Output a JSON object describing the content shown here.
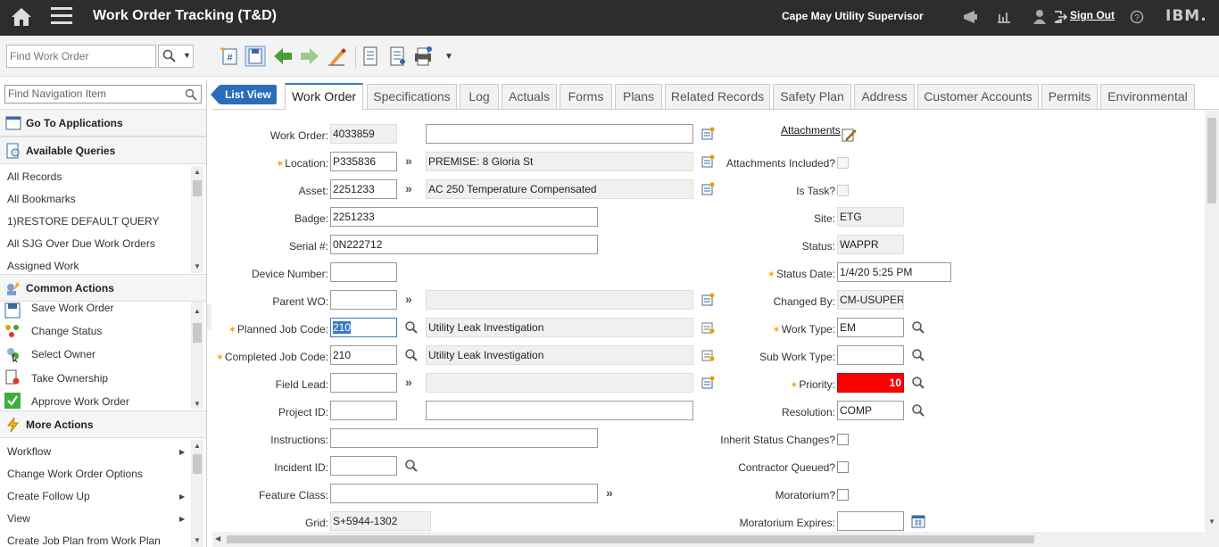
{
  "header": {
    "title": "Work Order Tracking (T&D)",
    "user": "Cape May Utility Supervisor",
    "sign_out": "Sign Out",
    "brand": "IBM."
  },
  "toolbar": {
    "find_placeholder": "Find Work Order"
  },
  "nav": {
    "search_placeholder": "Find Navigation Item",
    "go_to_apps": "Go To Applications",
    "available_queries": "Available Queries",
    "queries": [
      "All Records",
      "All Bookmarks",
      "1)RESTORE DEFAULT QUERY",
      "All SJG Over Due Work Orders",
      "Assigned Work"
    ],
    "common_actions": "Common Actions",
    "actions": [
      "Save Work Order",
      "Change Status",
      "Select Owner",
      "Take Ownership",
      "Approve Work Order"
    ],
    "more_actions": "More Actions",
    "more": [
      "Workflow",
      "Change Work Order Options",
      "Create Follow Up",
      "View",
      "Create Job Plan from Work Plan"
    ]
  },
  "tabs": {
    "list_view": "List View",
    "items": [
      "Work Order",
      "Specifications",
      "Log",
      "Actuals",
      "Forms",
      "Plans",
      "Related Records",
      "Safety Plan",
      "Address",
      "Customer Accounts",
      "Permits",
      "Environmental"
    ]
  },
  "form": {
    "work_order": {
      "label": "Work Order:",
      "value": "4033859",
      "desc": ""
    },
    "location": {
      "label": "Location:",
      "value": "P335836",
      "desc": "PREMISE: 8 Gloria St"
    },
    "asset": {
      "label": "Asset:",
      "value": "2251233",
      "desc": "AC 250 Temperature Compensated"
    },
    "badge": {
      "label": "Badge:",
      "value": "2251233"
    },
    "serial": {
      "label": "Serial #:",
      "value": "0N222712"
    },
    "device_number": {
      "label": "Device Number:",
      "value": ""
    },
    "parent_wo": {
      "label": "Parent WO:",
      "value": ""
    },
    "planned_job_code": {
      "label": "Planned Job Code:",
      "value": "210",
      "desc": "Utility Leak Investigation"
    },
    "completed_job_code": {
      "label": "Completed Job Code:",
      "value": "210",
      "desc": "Utility Leak Investigation"
    },
    "field_lead": {
      "label": "Field Lead:",
      "value": ""
    },
    "project_id": {
      "label": "Project ID:",
      "value": ""
    },
    "instructions": {
      "label": "Instructions:",
      "value": ""
    },
    "incident_id": {
      "label": "Incident ID:",
      "value": ""
    },
    "feature_class": {
      "label": "Feature Class:",
      "value": ""
    },
    "grid": {
      "label": "Grid:",
      "value": "S+5944-1302"
    },
    "attachments": "Attachments",
    "attachments_included": "Attachments Included?",
    "is_task": "Is Task?",
    "site": {
      "label": "Site:",
      "value": "ETG"
    },
    "status": {
      "label": "Status:",
      "value": "WAPPR"
    },
    "status_date": {
      "label": "Status Date:",
      "value": "1/4/20 5:25 PM"
    },
    "changed_by": {
      "label": "Changed By:",
      "value": "CM-USUPERV"
    },
    "work_type": {
      "label": "Work Type:",
      "value": "EM"
    },
    "sub_work_type": {
      "label": "Sub Work Type:",
      "value": ""
    },
    "priority": {
      "label": "Priority:",
      "value": "10",
      "color": "#ff0000"
    },
    "resolution": {
      "label": "Resolution:",
      "value": "COMP"
    },
    "inherit_status": "Inherit Status Changes?",
    "contractor_queued": "Contractor Queued?",
    "moratorium": "Moratorium?",
    "moratorium_expires": {
      "label": "Moratorium Expires:",
      "value": ""
    }
  }
}
